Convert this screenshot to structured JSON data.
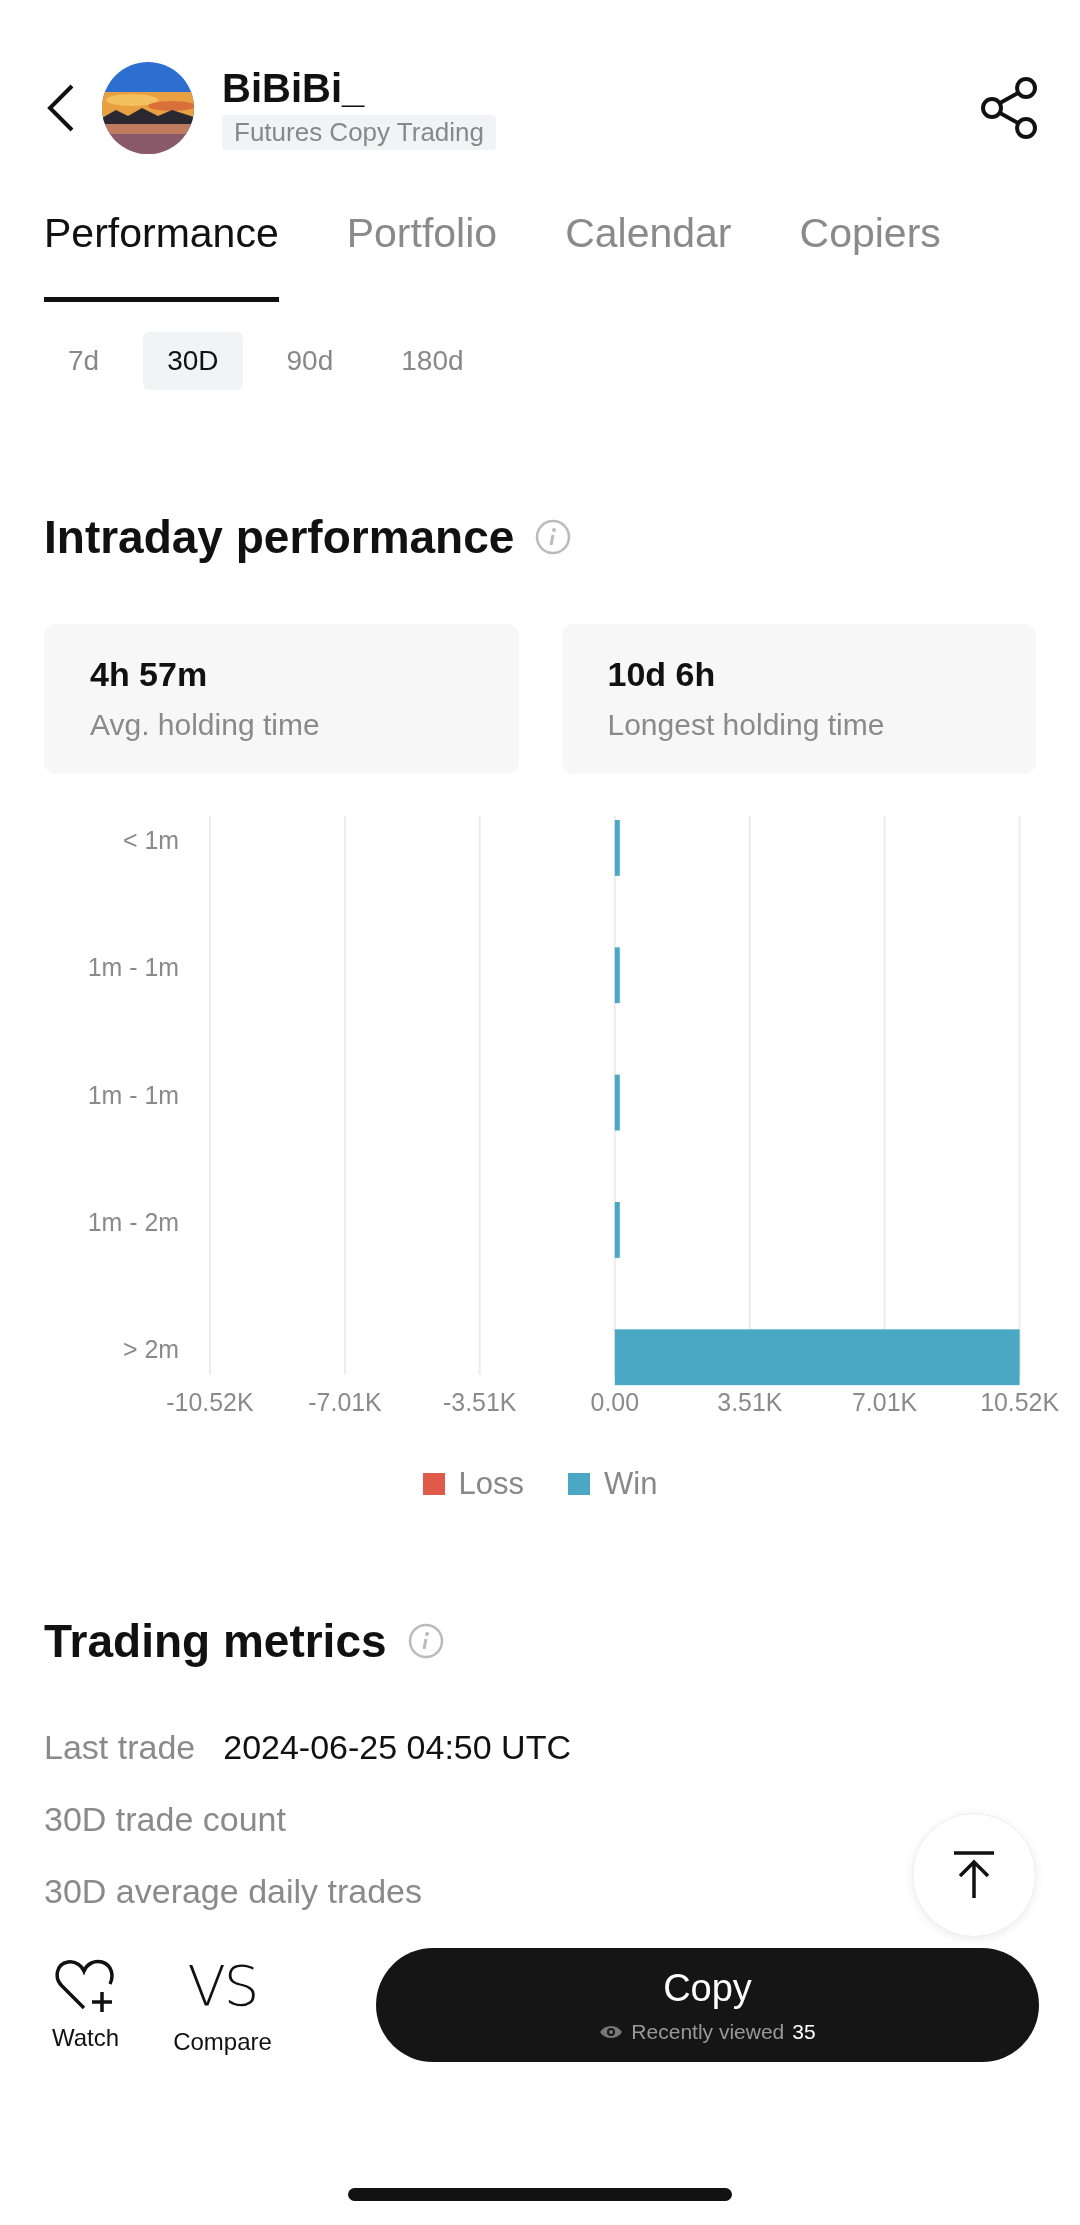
{
  "header": {
    "name": "BiBiBi_",
    "tag": "Futures Copy Trading"
  },
  "tabs": [
    {
      "label": "Performance",
      "selected": true
    },
    {
      "label": "Portfolio",
      "selected": false
    },
    {
      "label": "Calendar",
      "selected": false
    },
    {
      "label": "Copiers",
      "selected": false
    }
  ],
  "periods": [
    {
      "label": "7d",
      "selected": false
    },
    {
      "label": "30D",
      "selected": true
    },
    {
      "label": "90d",
      "selected": false
    },
    {
      "label": "180d",
      "selected": false
    }
  ],
  "intraday": {
    "title": "Intraday performance",
    "cards": [
      {
        "value": "4h 57m",
        "label": "Avg. holding time"
      },
      {
        "value": "10d 6h",
        "label": "Longest holding time"
      }
    ],
    "chart_data": {
      "type": "bar",
      "orientation": "horizontal",
      "stacked": true,
      "grid": true,
      "categories": [
        "< 1m",
        "1m - 1m",
        "1m - 1m",
        "1m - 2m",
        "> 2m"
      ],
      "series": [
        {
          "name": "Loss",
          "color": "#e05a4a",
          "values": [
            0,
            0,
            0,
            0,
            0
          ]
        },
        {
          "name": "Win",
          "color": "#4aa8c4",
          "values": [
            130,
            130,
            130,
            130,
            10520
          ]
        }
      ],
      "xlim": [
        -10520,
        10520
      ],
      "xticks": [
        {
          "value": -10520,
          "label": "-10.52K"
        },
        {
          "value": -7010,
          "label": "-7.01K"
        },
        {
          "value": -3510,
          "label": "-3.51K"
        },
        {
          "value": 0,
          "label": "0.00"
        },
        {
          "value": 3510,
          "label": "3.51K"
        },
        {
          "value": 7010,
          "label": "7.01K"
        },
        {
          "value": 10520,
          "label": "10.52K"
        }
      ]
    }
  },
  "metrics": {
    "title": "Trading metrics",
    "rows": [
      {
        "label": "Last trade",
        "value": "2024-06-25 04:50 UTC"
      },
      {
        "label": "30D trade count"
      },
      {
        "label": "30D average daily trades"
      }
    ]
  },
  "bottom_bar": {
    "watch": "Watch",
    "compare_icon": "VS",
    "compare": "Compare",
    "copy": "Copy",
    "viewed_label": "Recently viewed",
    "viewed_count": "35"
  }
}
